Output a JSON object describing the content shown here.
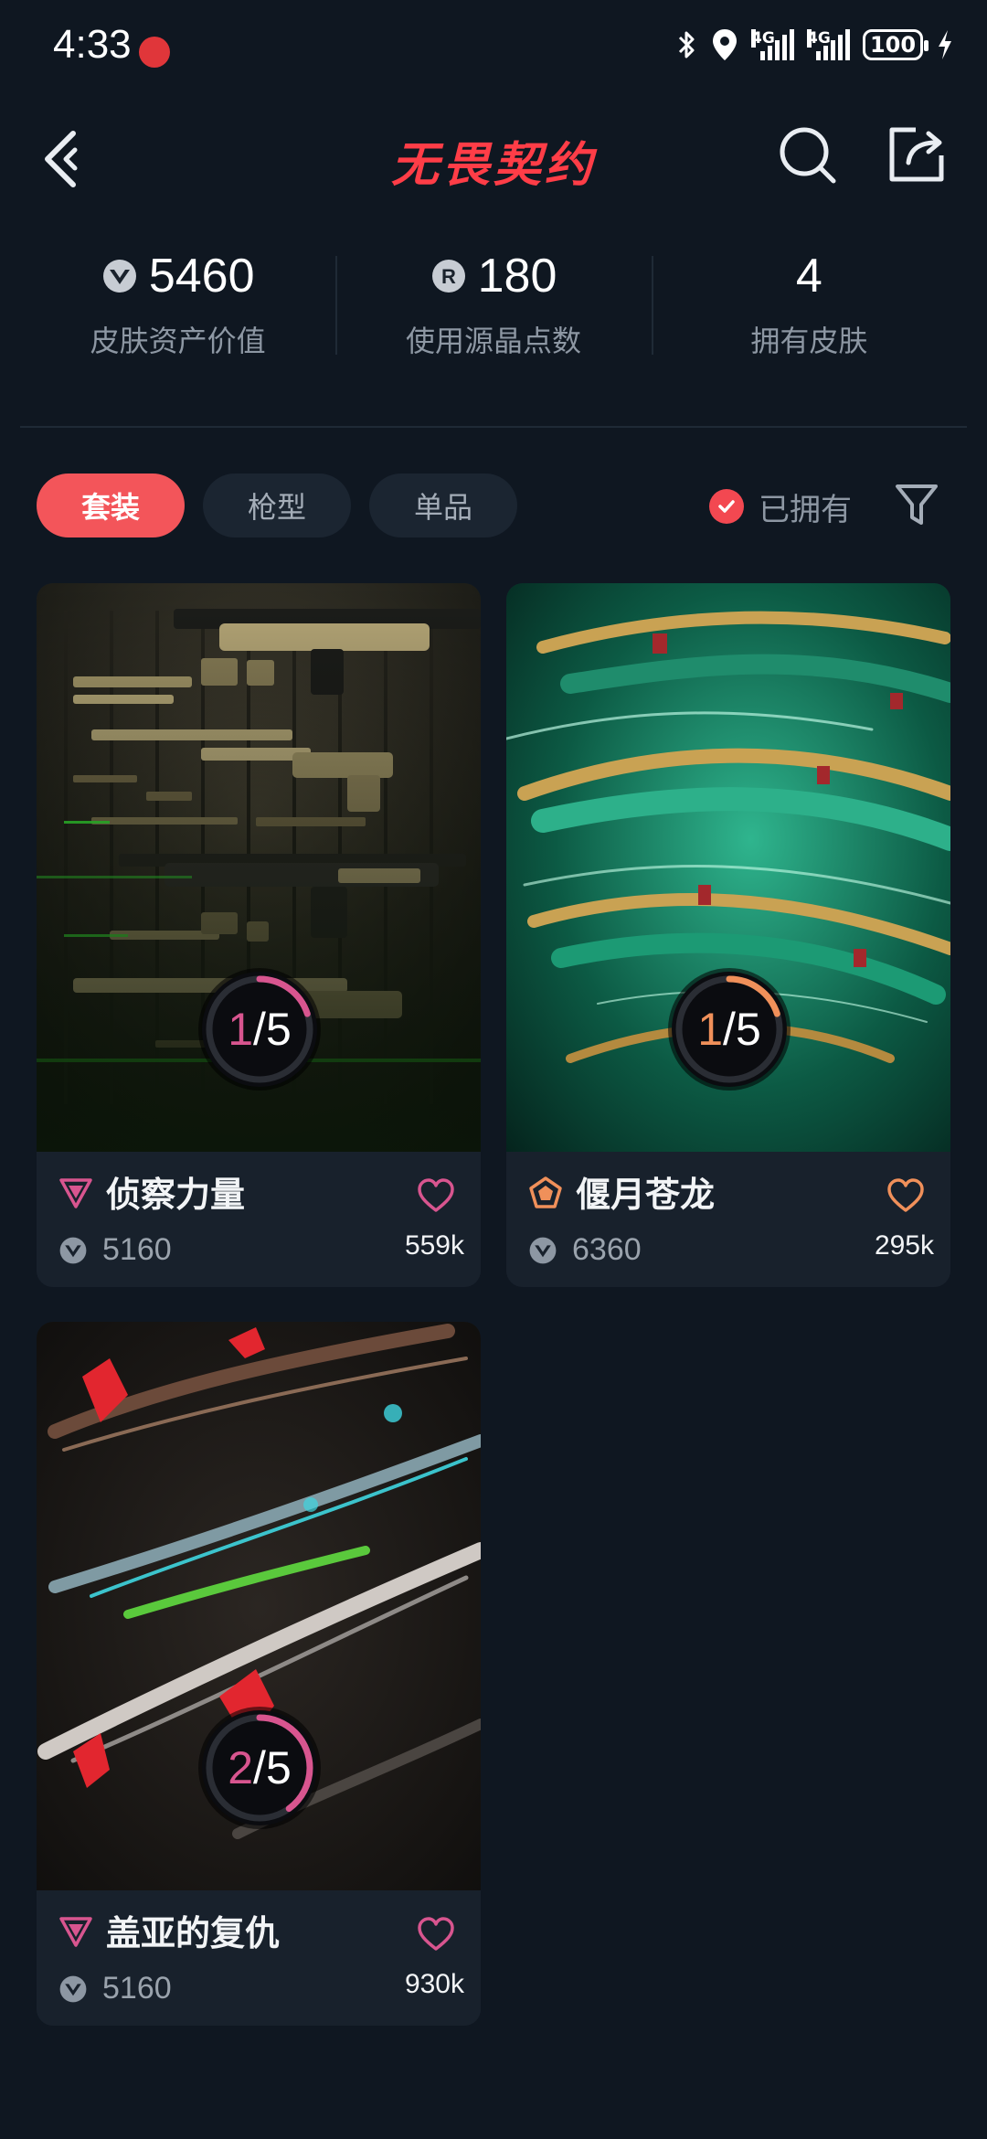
{
  "status": {
    "time": "4:33",
    "network_1": "4G",
    "network_2": "4G",
    "battery": "100"
  },
  "header": {
    "title": "无畏契约",
    "icons": [
      "back-icon",
      "search-icon",
      "share-icon"
    ]
  },
  "stats": [
    {
      "icon": "vp-coin-icon",
      "value": "5460",
      "label": "皮肤资产价值"
    },
    {
      "icon": "radianite-icon",
      "value": "180",
      "label": "使用源晶点数"
    },
    {
      "icon": "",
      "value": "4",
      "label": "拥有皮肤"
    }
  ],
  "filters": {
    "tabs": [
      {
        "label": "套装",
        "active": true
      },
      {
        "label": "枪型",
        "active": false
      },
      {
        "label": "单品",
        "active": false
      }
    ],
    "owned_label": "已拥有",
    "owned_checked": true
  },
  "cards": [
    {
      "name": "侦察力量",
      "price": "5160",
      "likes": "559k",
      "progress_current": "1",
      "progress_total": "5",
      "progress_fraction": 0.2,
      "accent": "#d8558f",
      "tier_icon": "premium-tier-icon"
    },
    {
      "name": "偃月苍龙",
      "price": "6360",
      "likes": "295k",
      "progress_current": "1",
      "progress_total": "5",
      "progress_fraction": 0.2,
      "accent": "#f0905a",
      "tier_icon": "exclusive-tier-icon"
    },
    {
      "name": "盖亚的复仇",
      "price": "5160",
      "likes": "930k",
      "progress_current": "2",
      "progress_total": "5",
      "progress_fraction": 0.4,
      "accent": "#d8558f",
      "tier_icon": "premium-tier-icon"
    }
  ],
  "colors": {
    "background": "#0f1721",
    "brand": "#ff3d47",
    "active_chip": "#f3555a",
    "premium": "#d8558f",
    "exclusive": "#f0905a"
  }
}
